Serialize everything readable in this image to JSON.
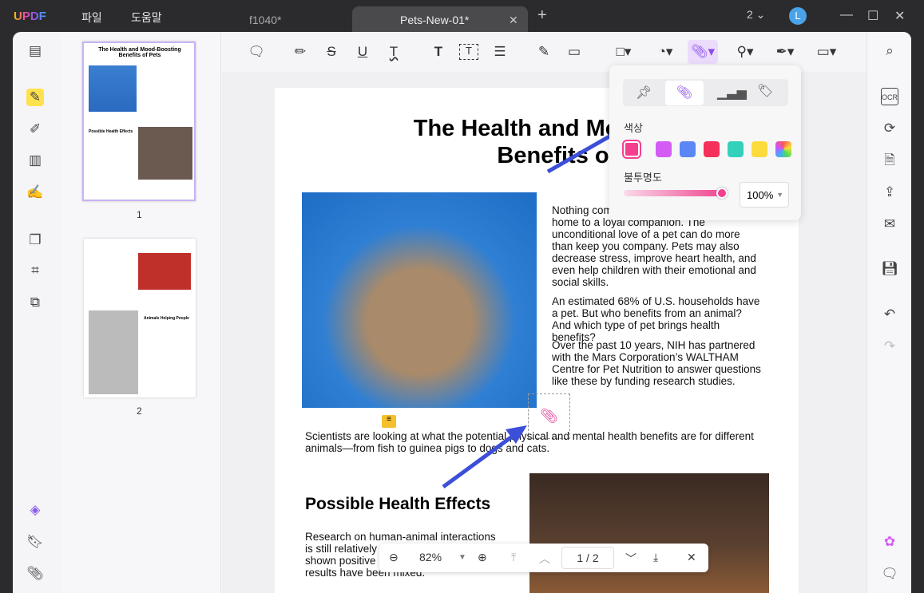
{
  "app": {
    "logo": "UPDF",
    "menu": [
      "파일",
      "도움말"
    ],
    "tabs": [
      "f1040*",
      "Pets-New-01*"
    ],
    "new_tab": "+",
    "window_count": "2",
    "avatar": "L"
  },
  "thumbnails": [
    {
      "page": "1",
      "title": "The Health and Mood-Boosting Benefits of Pets",
      "heading": "Possible Health Effects"
    },
    {
      "page": "2",
      "heading": "Animals Helping People"
    }
  ],
  "popup": {
    "color_label": "색상",
    "colors": [
      "#f43f8e",
      "#d45cf5",
      "#5b86f5",
      "#f5305a",
      "#33d1bc",
      "#fbdc3c",
      "rainbow"
    ],
    "opacity_label": "불투명도",
    "opacity_value": "100%",
    "opacity": 1.0
  },
  "document": {
    "title_line1": "The Health and Mood-Boosting",
    "title_line2": "Benefits of Pets",
    "para1": "Nothing compares to the joy of coming home to a loyal companion. The unconditional love of a pet can do more than keep you company. Pets may also decrease stress, improve heart health, and even help children with their emotional and social skills.",
    "para2": "An estimated 68% of U.S. households have a pet. But who benefits from an animal? And which type of pet brings health benefits?",
    "para3": "Over the past 10 years, NIH has partnered with the Mars Corporation’s WALTHAM Centre for Pet Nutrition to answer questions like these by funding research studies.",
    "para4": "Scientists are looking at what the potential physical and mental health benefits are for different animals—from fish to guinea pigs to dogs and cats.",
    "heading2": "Possible Health Effects",
    "para5": "Research on human-animal interactions is still relatively new. Some studies have shown positive health effects, but the results have been mixed."
  },
  "navbar": {
    "zoom": "82%",
    "page": "1 / 2"
  }
}
